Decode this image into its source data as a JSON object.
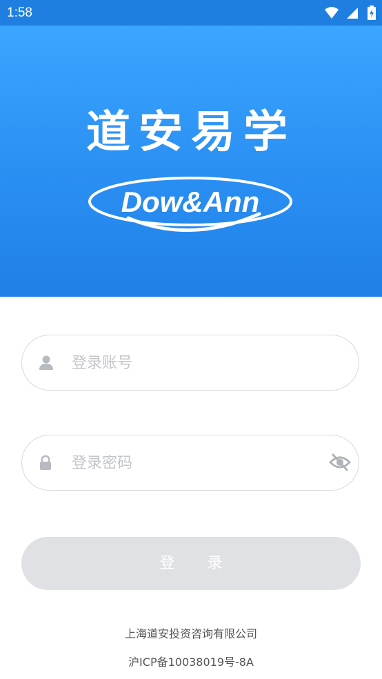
{
  "status_bar": {
    "time": "1:58",
    "icons": [
      "wifi-icon",
      "cellular-signal-icon",
      "battery-charging-icon"
    ],
    "background": "#1e7fe0"
  },
  "hero": {
    "title": "道安易学",
    "logo_text": "Dow&Ann",
    "gradient": [
      "#3aa6ff",
      "#1f80e8"
    ]
  },
  "form": {
    "username": {
      "placeholder": "登录账号",
      "value": "",
      "icon": "user-icon"
    },
    "password": {
      "placeholder": "登录密码",
      "value": "",
      "icon": "lock-icon",
      "toggle_icon": "eye-off-icon"
    },
    "login_label": "登 录"
  },
  "footer": {
    "company": "上海道安投资咨询有限公司",
    "icp": "沪ICP备10038019号-8A"
  }
}
